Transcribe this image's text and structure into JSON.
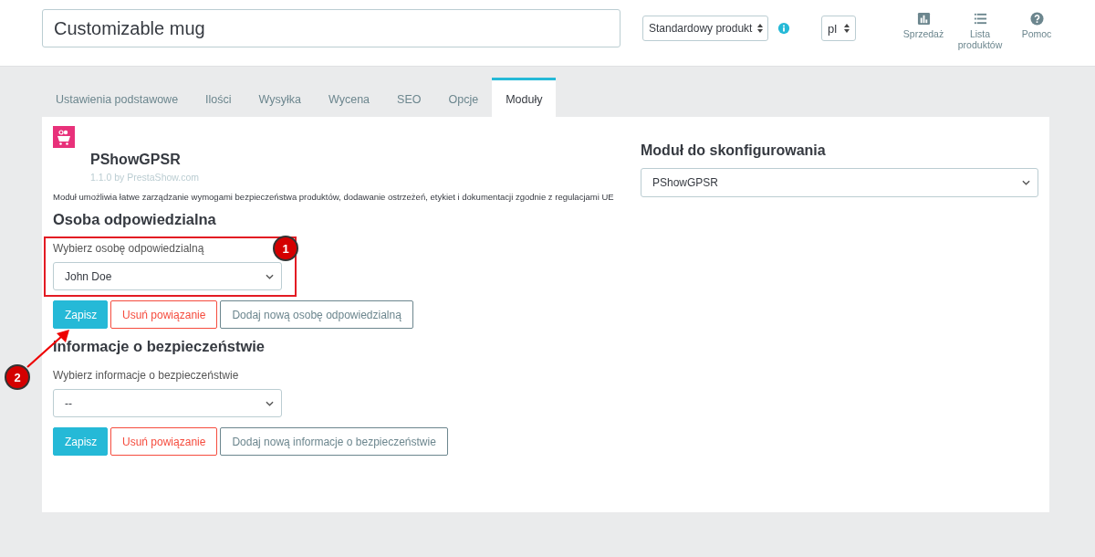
{
  "header": {
    "product_name": "Customizable mug",
    "product_type": "Standardowy produkt",
    "language": "pl",
    "actions": [
      {
        "kind": "chart",
        "label": "Sprzedaż"
      },
      {
        "kind": "list",
        "label": "Lista produktów"
      },
      {
        "kind": "help",
        "label": "Pomoc"
      }
    ]
  },
  "tabs": [
    {
      "label": "Ustawienia podstawowe",
      "selected": false
    },
    {
      "label": "Ilości",
      "selected": false
    },
    {
      "label": "Wysyłka",
      "selected": false
    },
    {
      "label": "Wycena",
      "selected": false
    },
    {
      "label": "SEO",
      "selected": false
    },
    {
      "label": "Opcje",
      "selected": false
    },
    {
      "label": "Moduły",
      "selected": true
    }
  ],
  "module": {
    "name": "PShowGPSR",
    "version": "1.1.0 by PrestaShow.com",
    "description": "Moduł umożliwia łatwe zarządzanie wymogami bezpieczeństwa produktów, dodawanie ostrzeżeń, etykiet i dokumentacji zgodnie z regulacjami UE"
  },
  "configure": {
    "heading": "Moduł do skonfigurowania",
    "value": "PShowGPSR"
  },
  "sections": [
    {
      "heading": "Osoba odpowiedzialna",
      "label": "Wybierz osobę odpowiedzialną",
      "value": "John Doe",
      "highlighted": true,
      "buttons": [
        {
          "kind": "primary",
          "label": "Zapisz"
        },
        {
          "kind": "danger",
          "label": "Usuń powiązanie"
        },
        {
          "kind": "outline",
          "label": "Dodaj nową osobę odpowiedzialną"
        }
      ]
    },
    {
      "heading": "Informacje o bezpieczeństwie",
      "label": "Wybierz informacje o bezpieczeństwie",
      "value": "--",
      "highlighted": false,
      "buttons": [
        {
          "kind": "primary",
          "label": "Zapisz"
        },
        {
          "kind": "danger",
          "label": "Usuń powiązanie"
        },
        {
          "kind": "outline",
          "label": "Dodaj nową informacje o bezpieczeństwie"
        }
      ]
    }
  ],
  "callouts": [
    "1",
    "2"
  ]
}
